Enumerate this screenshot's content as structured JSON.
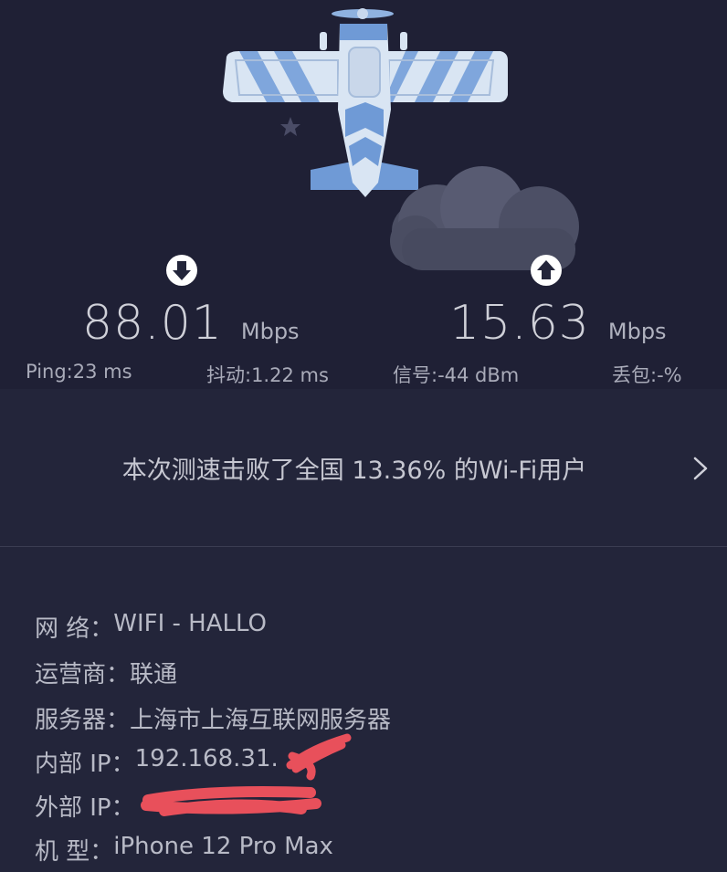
{
  "colors": {
    "background": "#23253a",
    "hero_background": "#1f2035",
    "text": "#c9cad3",
    "redaction": "#e8505b",
    "plane_blue": "#6f9ad6",
    "plane_light": "#d8e4f2"
  },
  "icons": {
    "download": "download-arrow-icon",
    "upload": "upload-arrow-icon",
    "banner": "chevron-right-icon"
  },
  "download": {
    "value": "88.01",
    "unit": "Mbps"
  },
  "upload": {
    "value": "15.63",
    "unit": "Mbps"
  },
  "metrics": {
    "ping": "Ping:23 ms",
    "jitter": "抖动:1.22 ms",
    "signal": "信号:-44 dBm",
    "loss": "丢包:-%"
  },
  "banner": {
    "text": "本次测速击败了全国 13.36% 的Wi-Fi用户"
  },
  "info": {
    "network": {
      "label": "网 络：",
      "value": "WIFI - HALLO"
    },
    "carrier": {
      "label": "运营商：",
      "value": "联通"
    },
    "server": {
      "label": "服务器：",
      "value": "上海市上海互联网服务器"
    },
    "internal_ip": {
      "label": "内部 IP：",
      "value": "192.168.31."
    },
    "external_ip": {
      "label": "外部 IP：",
      "value": ""
    },
    "model": {
      "label": "机 型：",
      "value": "iPhone 12 Pro Max"
    }
  }
}
